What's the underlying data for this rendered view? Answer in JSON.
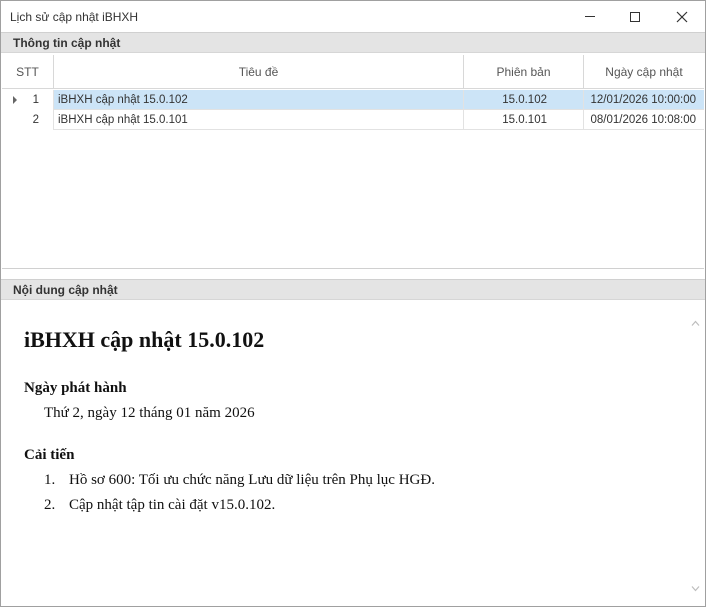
{
  "window": {
    "title": "Lịch sử cập nhật iBHXH",
    "controls": [
      "minimize-icon",
      "maximize-icon",
      "close-icon"
    ]
  },
  "info_section": {
    "header": "Thông tin cập nhật",
    "columns": [
      "STT",
      "Tiêu đề",
      "Phiên bản",
      "Ngày cập nhật"
    ],
    "rows": [
      {
        "stt": "1",
        "title": "iBHXH cập nhật 15.0.102",
        "version": "15.0.102",
        "date": "12/01/2026 10:00:00",
        "selected": true
      },
      {
        "stt": "2",
        "title": "iBHXH cập nhật 15.0.101",
        "version": "15.0.101",
        "date": "08/01/2026 10:08:00",
        "selected": false
      }
    ]
  },
  "content_section": {
    "header": "Nội dung cập nhật",
    "doc_title": "iBHXH cập nhật 15.0.102",
    "release_heading": "Ngày phát hành",
    "release_date": "Thứ 2, ngày 12 tháng 01 năm 2026",
    "improvements_heading": "Cải tiến",
    "improvements": [
      {
        "num": "1.",
        "text": "Hồ sơ 600: Tối ưu chức năng Lưu dữ liệu trên Phụ lục HGĐ."
      },
      {
        "num": "2.",
        "text": "Cập nhật tập tin cài đặt v15.0.102."
      }
    ]
  },
  "colors": {
    "selected_row": "#cce4f7",
    "section_header_bg": "#e4e4e4"
  }
}
